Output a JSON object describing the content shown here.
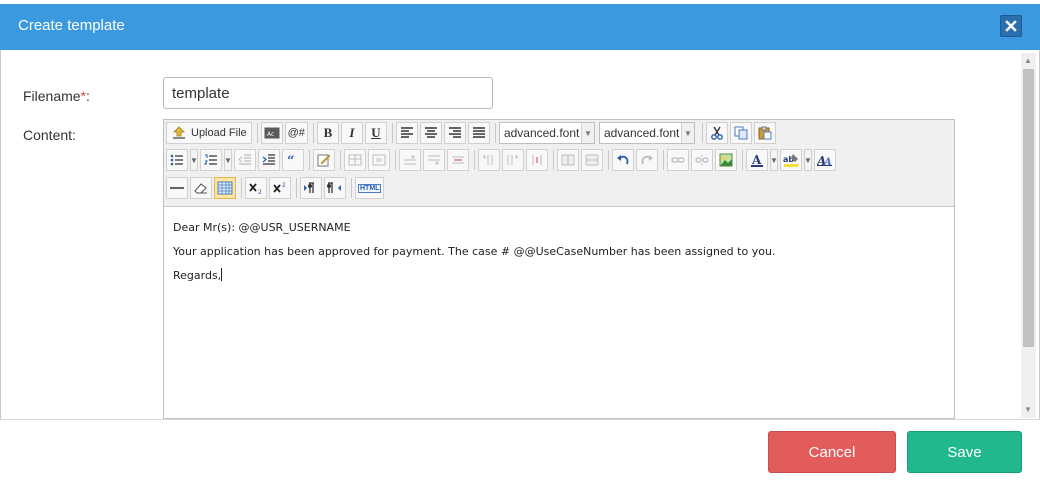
{
  "dialog": {
    "title": "Create template"
  },
  "form": {
    "filename_label": "Filename",
    "required_mark": "*",
    "colon": ":",
    "filename_value": "template",
    "content_label": "Content:"
  },
  "toolbar": {
    "upload_label": "Upload File",
    "macro_label": "@#",
    "bold": "B",
    "italic": "I",
    "underline": "U",
    "font_select_1": "advanced.font",
    "font_select_2": "advanced.font",
    "html_label": "HTML"
  },
  "content": {
    "lines": [
      "Dear Mr(s): @@USR_USERNAME",
      "Your application has been approved for payment. The case # @@UseCaseNumber has been assigned to you.",
      "Regards,"
    ]
  },
  "buttons": {
    "cancel": "Cancel",
    "save": "Save"
  },
  "colors": {
    "header": "#3b99e0",
    "cancel": "#e25c5c",
    "save": "#21b88e"
  }
}
